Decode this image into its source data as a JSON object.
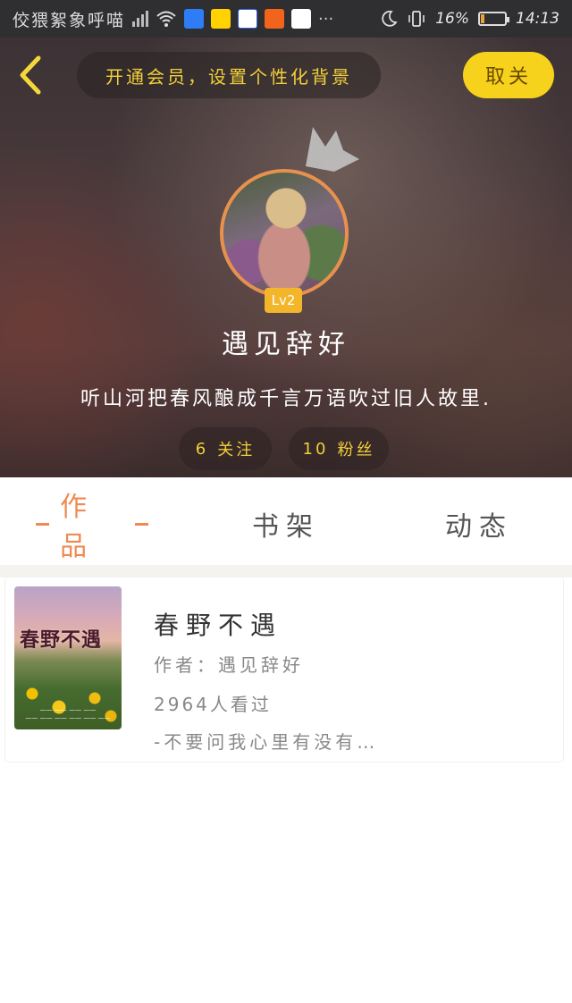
{
  "status_bar": {
    "notification_text": "佼猥絮象呼喵",
    "battery": "16%",
    "time": "14:13",
    "battery_level": 0.16
  },
  "header": {
    "vip_promo": "开通会员，设置个性化背景",
    "unfollow_label": "取关"
  },
  "profile": {
    "level": "Lv2",
    "username": "遇见辞好",
    "bio": "听山河把春风酿成千言万语吹过旧人故里.",
    "following_count": "6",
    "following_label": "关注",
    "fans_count": "10",
    "fans_label": "粉丝"
  },
  "tabs": {
    "works": "作品",
    "bookshelf": "书架",
    "dynamic": "动态"
  },
  "book": {
    "cover_title": "春野不遇",
    "title": "春野不遇",
    "author": "作者：遇见辞好",
    "reads": "2964人看过",
    "description": "-不要问我心里有没有…"
  },
  "colors": {
    "accent_orange": "#ee8a52",
    "vip_yellow": "#f2cf3a",
    "button_yellow": "#f7d21c",
    "avatar_ring": "#e7914f",
    "level_badge": "#f3b62a"
  }
}
